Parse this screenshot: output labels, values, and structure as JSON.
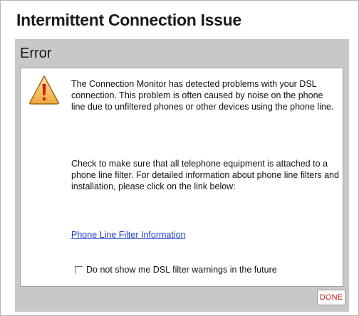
{
  "window": {
    "title": "Intermittent Connection Issue"
  },
  "panel": {
    "title": "Error",
    "icon": "warning-icon"
  },
  "message": {
    "paragraph1": "The Connection Monitor has detected problems with your DSL connection. This problem is often caused by noise on the phone line due to unfiltered phones or other devices using the phone line.",
    "paragraph2": "Check to make sure that all telephone equipment is attached to a phone line filter. For detailed information about phone line filters and installation, please click on the link below:"
  },
  "link": {
    "label": "Phone Line Filter Information"
  },
  "checkbox": {
    "label": "Do not show me DSL filter warnings in the future",
    "checked": false
  },
  "buttons": {
    "done_label": "DONE"
  },
  "colors": {
    "panel_bg": "#c8c8c8",
    "link": "#1a3fc8",
    "done_text": "#cc1a1a",
    "warning_fill": "#f2b84a",
    "warning_mark": "#d41818"
  }
}
